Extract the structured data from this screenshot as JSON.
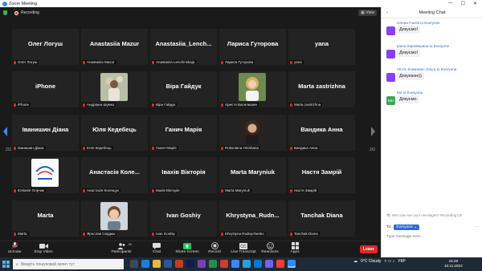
{
  "window": {
    "title": "Zoom Meeting",
    "controls": [
      "—",
      "☐",
      "✕"
    ]
  },
  "meeting": {
    "recording_label": "Recording",
    "view_label": "View",
    "page_left": "2/2",
    "page_right": "2/2"
  },
  "tiles": [
    {
      "name": "Олег Логуш",
      "label": "Олег Логуш",
      "type": "name"
    },
    {
      "name": "Anastasiia Mazur",
      "label": "Anastasiia Mazur",
      "type": "name"
    },
    {
      "name": "Anastasiia_Lench...",
      "label": "Anastasiia Lenchinskaja",
      "type": "name"
    },
    {
      "name": "Лариса Гуторова",
      "label": "Лариса Гуторова",
      "type": "name"
    },
    {
      "name": "yana",
      "label": "yana",
      "type": "name"
    },
    {
      "name": "iPhone",
      "label": "iPhone",
      "type": "name"
    },
    {
      "name": "",
      "label": "Андріана Шумко",
      "type": "photo",
      "photo": "girl-flowers"
    },
    {
      "name": "Віра Гайдук",
      "label": "Віра Гайдук",
      "type": "name"
    },
    {
      "name": "",
      "label": "Христя Василишин",
      "type": "photo",
      "photo": "girl-blonde"
    },
    {
      "name": "Marta zastrizhna",
      "label": "Marta zastrizhna",
      "type": "name"
    },
    {
      "name": "Іванишин Діана",
      "label": "Іванишин Діана",
      "type": "name"
    },
    {
      "name": "Юля Кедебець",
      "label": "Юля Кедебець",
      "type": "name"
    },
    {
      "name": "Ганич Марія",
      "label": "Ганич Марія",
      "type": "name"
    },
    {
      "name": "",
      "label": "Roksolana Hreshana",
      "type": "photo",
      "photo": "girl-dark"
    },
    {
      "name": "Вандика Анна",
      "label": "Вандика Анна",
      "type": "name"
    },
    {
      "name": "",
      "label": "Юліанія Огірчак",
      "type": "photo",
      "photo": "logo"
    },
    {
      "name": "Анастасія Коле...",
      "label": "Анастасія Колещук",
      "type": "name"
    },
    {
      "name": "Івахів Вікторія",
      "label": "Івахів Вікторія",
      "type": "name"
    },
    {
      "name": "Marta Maryniuk",
      "label": "Marta Maryniuk",
      "type": "name"
    },
    {
      "name": "Настя Замрій",
      "label": "Настя Замрій",
      "type": "name"
    },
    {
      "name": "Marta",
      "label": "Marta",
      "type": "name"
    },
    {
      "name": "",
      "label": "Ярослав Сердюк",
      "type": "photo",
      "photo": "man"
    },
    {
      "name": "Ivan Goshiy",
      "label": "Ivan Goshiy",
      "type": "name"
    },
    {
      "name": "Khrystyna_Rudn...",
      "label": "Khrystyna Rudnychenko",
      "type": "name"
    },
    {
      "name": "Tanchak Diana",
      "label": "Tanchak Diana",
      "type": "name"
    }
  ],
  "toolbar": {
    "unmute": "Unmute",
    "stop_video": "Stop Video",
    "participants": "Participants",
    "participants_count": "40",
    "chat": "Chat",
    "share_screen": "Share Screen",
    "record": "Record",
    "live_transcript": "Live Transcript",
    "reactions": "Reactions",
    "apps": "Apps",
    "leave": "Leave"
  },
  "chat": {
    "title": "Meeting Chat",
    "messages": [
      {
        "from": "Олена Гнатів to Everyone",
        "text": "Дякуємо!",
        "avatar": "",
        "color": "#8a3ffc"
      },
      {
        "from": "Ірина Карпявшина to Everyone",
        "text": "Дякуємо!",
        "avatar": "",
        "color": "#8a3ffc"
      },
      {
        "from": "УК-01 Климович Ольга to Everyone",
        "text": "Дякуююю))",
        "avatar": "",
        "color": "#8a3ffc"
      },
      {
        "from": "Me to Everyone",
        "text": "Дякуємо",
        "avatar": "MH",
        "color": "#3aa655"
      }
    ],
    "recording_note": "Who can see your messages? Recording On",
    "to_label": "To:",
    "to_value": "Everyone",
    "input_placeholder": "Type message here..."
  },
  "taskbar": {
    "search_placeholder": "Введіть пошуковий запит тут",
    "weather": "9°C  Cloudy",
    "lang": "УКР",
    "time": "16:28",
    "date": "10.11.2022"
  }
}
